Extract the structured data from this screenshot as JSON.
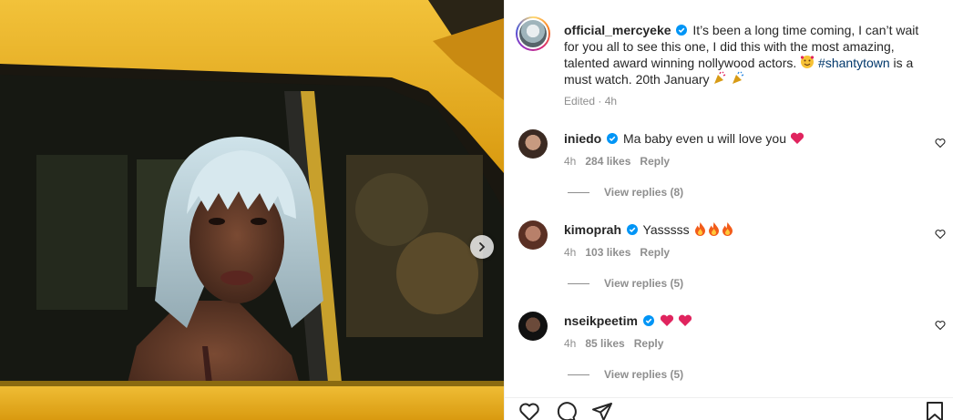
{
  "post": {
    "username": "official_mercyeke",
    "caption_text": "It’s been a long time coming, I can’t wait for you all to see this one, I did this with the most amazing, talented award winning nollywood actors.",
    "hashtag": "#shantytown",
    "caption_tail": "is a must watch. 20th January",
    "edited": "Edited",
    "time": "4h"
  },
  "comments": [
    {
      "username": "iniedo",
      "text": "Ma baby even u will love you",
      "time": "4h",
      "likes": "284 likes",
      "reply": "Reply",
      "view_replies": "View replies (8)"
    },
    {
      "username": "kimoprah",
      "text": "Yasssss",
      "time": "4h",
      "likes": "103 likes",
      "reply": "Reply",
      "view_replies": "View replies (5)"
    },
    {
      "username": "nseikpeetim",
      "text": "",
      "time": "4h",
      "likes": "85 likes",
      "reply": "Reply",
      "view_replies": "View replies (5)"
    }
  ],
  "icons": {
    "verified": "verified-badge-icon",
    "like": "heart-icon",
    "comment": "comment-bubble-icon",
    "share": "paper-plane-icon",
    "save": "bookmark-icon",
    "next": "chevron-right-icon"
  },
  "colors": {
    "verified_blue": "#0095f6",
    "hashtag": "#00376b",
    "heart_red": "#e0245e",
    "taxi_yellow": "#e8b21c"
  }
}
